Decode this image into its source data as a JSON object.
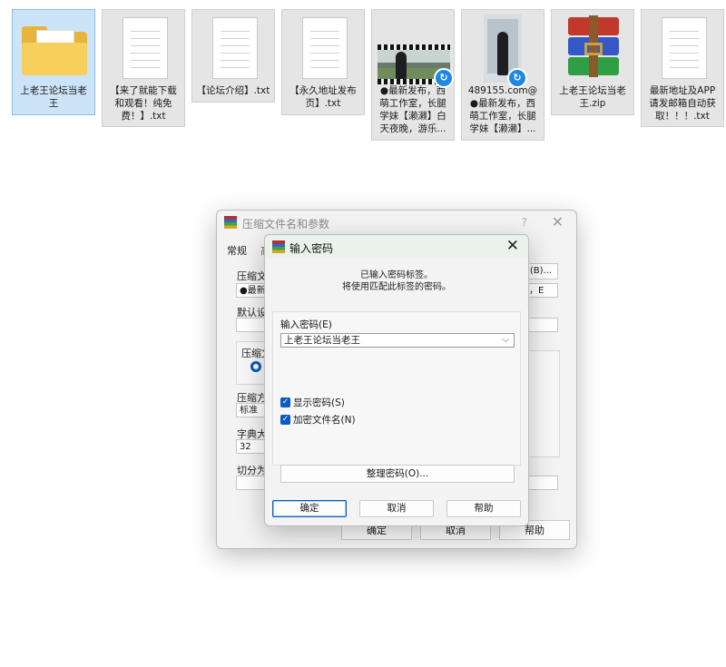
{
  "files": [
    {
      "name": "上老王论坛当老王",
      "icon": "folder-icon",
      "selected": true
    },
    {
      "name": "【来了就能下载和观看！纯免费！】.txt",
      "icon": "text-file-icon"
    },
    {
      "name": "【论坛介绍】.txt",
      "icon": "text-file-icon"
    },
    {
      "name": "【永久地址发布页】.txt",
      "icon": "text-file-icon"
    },
    {
      "name": "●最新发布，西萌工作室，长腿学妹【濑濑】白天夜晚，游乐...",
      "icon": "video-thumbnail-icon"
    },
    {
      "name": "489155.com@●最新发布，西萌工作室，长腿学妹【濑濑】...",
      "icon": "video-thumbnail-icon"
    },
    {
      "name": "上老王论坛当老王.zip",
      "icon": "winrar-archive-icon"
    },
    {
      "name": "最新地址及APP请发邮箱自动获取！！！.txt",
      "icon": "text-file-icon"
    }
  ],
  "back_dialog": {
    "title": "压缩文件名和参数",
    "help_mark": "?",
    "tab_general": "常规",
    "tab_partial": "高",
    "archive_name_label": "压缩文",
    "archive_name_value": "●最新",
    "browse_button": "(B)...",
    "format_partial": "，E",
    "default_settings": "默认设",
    "format_group": "压缩文",
    "method_label": "压缩方",
    "method_value": "标准",
    "dict_label": "字典大小",
    "dict_value": "32",
    "split_label": "切分为分",
    "ok": "确定",
    "cancel": "取消",
    "help": "帮助"
  },
  "password_dialog": {
    "title": "输入密码",
    "message_line1": "已输入密码标签。",
    "message_line2": "将使用匹配此标签的密码。",
    "password_label": "输入密码(E)",
    "password_value": "上老王论坛当老王",
    "show_password": "显示密码(S)",
    "encrypt_filenames": "加密文件名(N)",
    "show_password_checked": true,
    "encrypt_filenames_checked": true,
    "organize_button": "整理密码(O)...",
    "ok": "确定",
    "cancel": "取消",
    "help": "帮助"
  }
}
